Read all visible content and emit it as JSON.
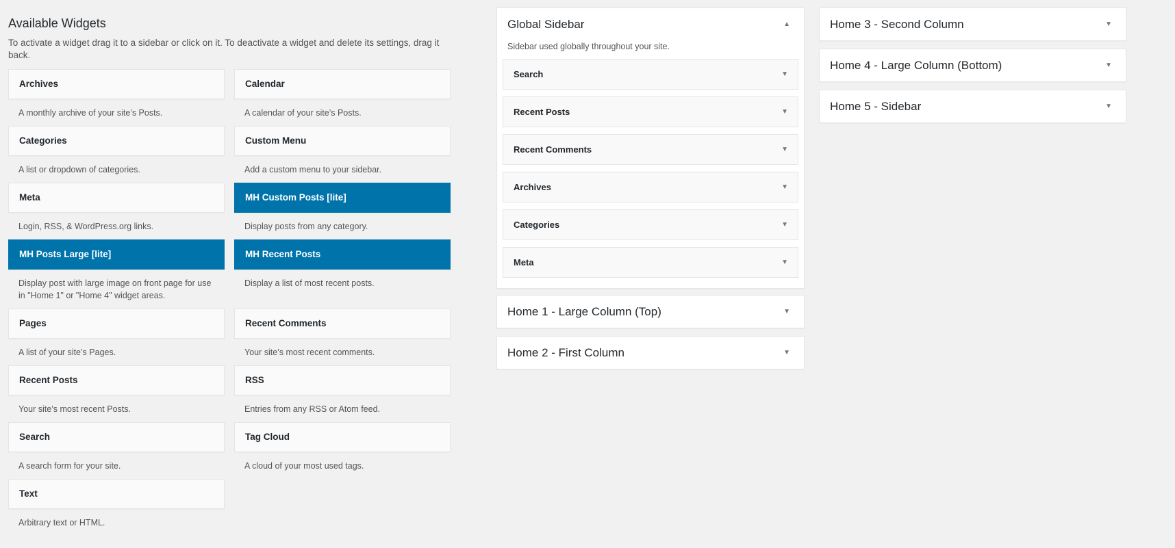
{
  "available": {
    "title": "Available Widgets",
    "intro": "To activate a widget drag it to a sidebar or click on it. To deactivate a widget and delete its settings, drag it back.",
    "widgets": [
      {
        "name": "Archives",
        "desc": "A monthly archive of your site’s Posts.",
        "highlighted": false
      },
      {
        "name": "Calendar",
        "desc": "A calendar of your site’s Posts.",
        "highlighted": false
      },
      {
        "name": "Categories",
        "desc": "A list or dropdown of categories.",
        "highlighted": false
      },
      {
        "name": "Custom Menu",
        "desc": "Add a custom menu to your sidebar.",
        "highlighted": false
      },
      {
        "name": "Meta",
        "desc": "Login, RSS, & WordPress.org links.",
        "highlighted": false
      },
      {
        "name": "MH Custom Posts [lite]",
        "desc": "Display posts from any category.",
        "highlighted": true
      },
      {
        "name": "MH Posts Large [lite]",
        "desc": "Display post with large image on front page for use in \"Home 1\" or \"Home 4\" widget areas.",
        "highlighted": true
      },
      {
        "name": "MH Recent Posts",
        "desc": "Display a list of most recent posts.",
        "highlighted": true
      },
      {
        "name": "Pages",
        "desc": "A list of your site’s Pages.",
        "highlighted": false
      },
      {
        "name": "Recent Comments",
        "desc": "Your site’s most recent comments.",
        "highlighted": false
      },
      {
        "name": "Recent Posts",
        "desc": "Your site’s most recent Posts.",
        "highlighted": false
      },
      {
        "name": "RSS",
        "desc": "Entries from any RSS or Atom feed.",
        "highlighted": false
      },
      {
        "name": "Search",
        "desc": "A search form for your site.",
        "highlighted": false
      },
      {
        "name": "Tag Cloud",
        "desc": "A cloud of your most used tags.",
        "highlighted": false
      },
      {
        "name": "Text",
        "desc": "Arbitrary text or HTML.",
        "highlighted": false
      }
    ]
  },
  "sidebars": {
    "global": {
      "title": "Global Sidebar",
      "desc": "Sidebar used globally throughout your site.",
      "items": [
        "Search",
        "Recent Posts",
        "Recent Comments",
        "Archives",
        "Categories",
        "Meta"
      ]
    },
    "home1": {
      "title": "Home 1 - Large Column (Top)"
    },
    "home2": {
      "title": "Home 2 - First Column"
    },
    "home3": {
      "title": "Home 3 - Second Column"
    },
    "home4": {
      "title": "Home 4 - Large Column (Bottom)"
    },
    "home5": {
      "title": "Home 5 - Sidebar"
    }
  },
  "icons": {
    "collapse": "▲",
    "expand": "▼"
  },
  "colors": {
    "accent": "#0073aa",
    "background": "#f1f1f1"
  }
}
